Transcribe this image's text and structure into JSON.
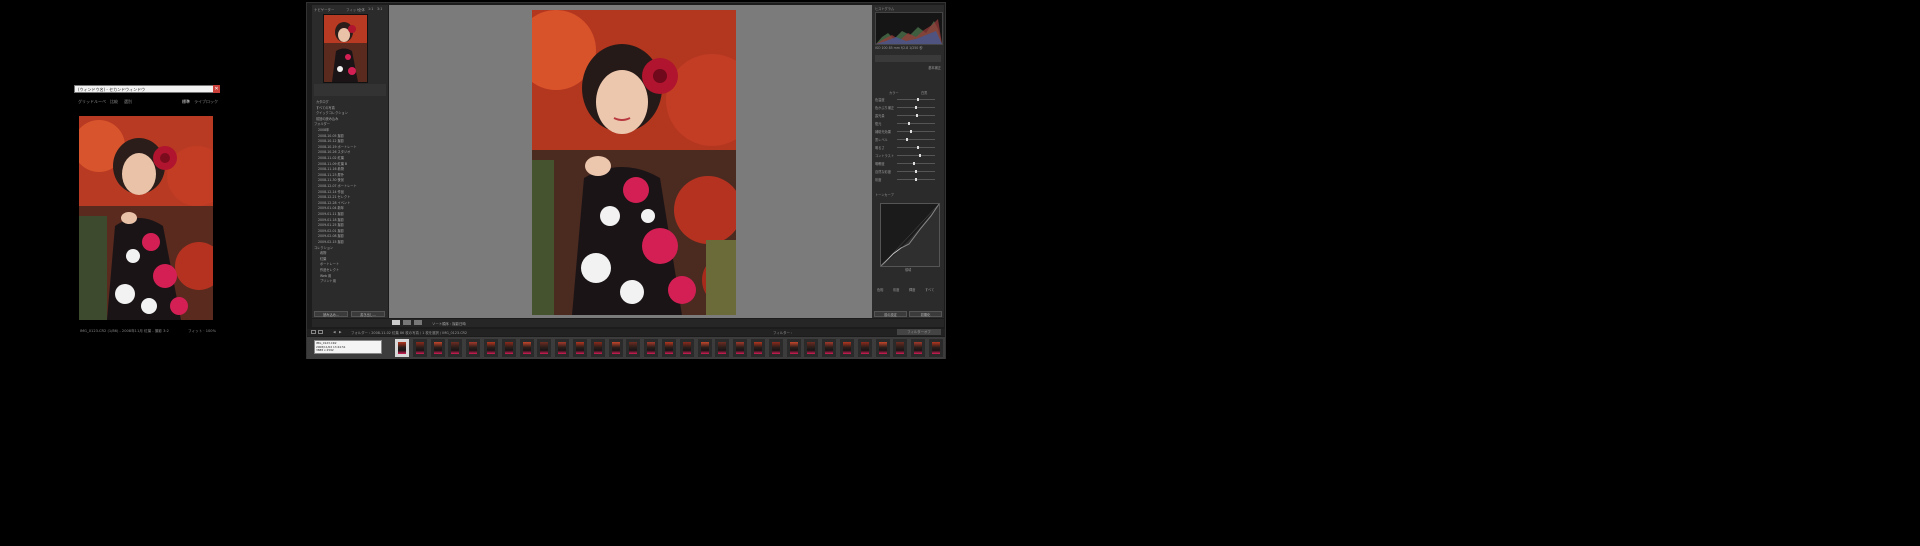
{
  "second_window": {
    "title": "(ウィンドウ名) - セカンドウィンドウ",
    "close_label": "✕",
    "tabs": [
      "グリッド",
      "ルーペ",
      "比較",
      "選別"
    ],
    "view_tabs": [
      "標準",
      "ライブ",
      "ロック"
    ],
    "status": "IMG_0123.CR2 (1/86) - 2008年11月 紅葉 - 撮影 3:2",
    "zoom": "フィット · 100%"
  },
  "left_panel": {
    "navigator_label": "ナビゲーター",
    "nav_zoom": [
      "フィット",
      "全体",
      "1:1",
      "3:1"
    ],
    "catalog_items": [
      "カタログ",
      "すべての写真",
      "クイックコレクション",
      "前回の読み込み"
    ],
    "folders_header": "フォルダー",
    "folder_items": [
      "2008年",
      "2008-10-05 撮影",
      "2008-10-12 撮影",
      "2008-10-19 ポートレート",
      "2008-10-26 スタジオ",
      "2008-11-02 紅葉",
      "2008-11-09 紅葉 B",
      "2008-11-16 着物",
      "2008-11-23 屋外",
      "2008-11-30 夜景",
      "2008-12-07 ポートレート",
      "2008-12-14 作品",
      "2008-12-21 セレクト",
      "2008-12-28 イベント",
      "2009-01-04 新年",
      "2009-01-11 撮影",
      "2009-01-18 撮影",
      "2009-01-25 撮影",
      "2009-02-01 撮影",
      "2009-02-08 撮影",
      "2009-02-15 撮影"
    ],
    "collections_header": "コレクション",
    "collection_items": [
      "着物",
      "紅葉",
      "ポートレート",
      "作品セレクト",
      "Web 用",
      "プリント用"
    ],
    "import_button": "読み込み...",
    "export_button": "書き出し..."
  },
  "right_panel": {
    "histogram_label": "ヒストグラム",
    "exif": "ISO 100  85 mm  f/2.8  1/250 秒",
    "basic_label": "基本補正",
    "treatment": [
      "カラー",
      "白黒"
    ],
    "sliders": [
      {
        "label": "色温度",
        "value": 0.55
      },
      {
        "label": "色かぶり補正",
        "value": 0.5
      },
      {
        "label": "露光量",
        "value": 0.52
      },
      {
        "label": "復元",
        "value": 0.3
      },
      {
        "label": "補助光効果",
        "value": 0.35
      },
      {
        "label": "黒レベル",
        "value": 0.25
      },
      {
        "label": "明るさ",
        "value": 0.55
      },
      {
        "label": "コントラスト",
        "value": 0.6
      },
      {
        "label": "明瞭度",
        "value": 0.45
      },
      {
        "label": "自然な彩度",
        "value": 0.5
      },
      {
        "label": "彩度",
        "value": 0.5
      }
    ],
    "tone_curve_label": "トーンカーブ",
    "curve_region": "領域",
    "curve_sliders": [
      "ハイライト",
      "ライト",
      "ダーク",
      "シャドウ"
    ],
    "hsl_tabs": [
      "色相",
      "彩度",
      "輝度",
      "すべて"
    ],
    "prev_button": "前の設定",
    "reset_button": "初期化"
  },
  "toolbar": {
    "left_text": "",
    "sort_label": "ソート順序 : 撮影日時",
    "thumb_label": "サムネール"
  },
  "filmstrip_bar": {
    "path": "フォルダー : 2008-11-02 紅葉  86 枚の写真 / 1 枚を選択 / IMG_0123.CR2",
    "filter": "フィルター :",
    "filter_value": "フィルターオフ"
  },
  "filmstrip_tooltip": "IMG_0123.CR2\n2008/11/02 13:24:51\n3888 x 2592",
  "filmstrip_count": 31,
  "colors": {
    "panel": "#2b2b2b",
    "canvas": "#7b7b7b",
    "title_close": "#c9403a"
  }
}
